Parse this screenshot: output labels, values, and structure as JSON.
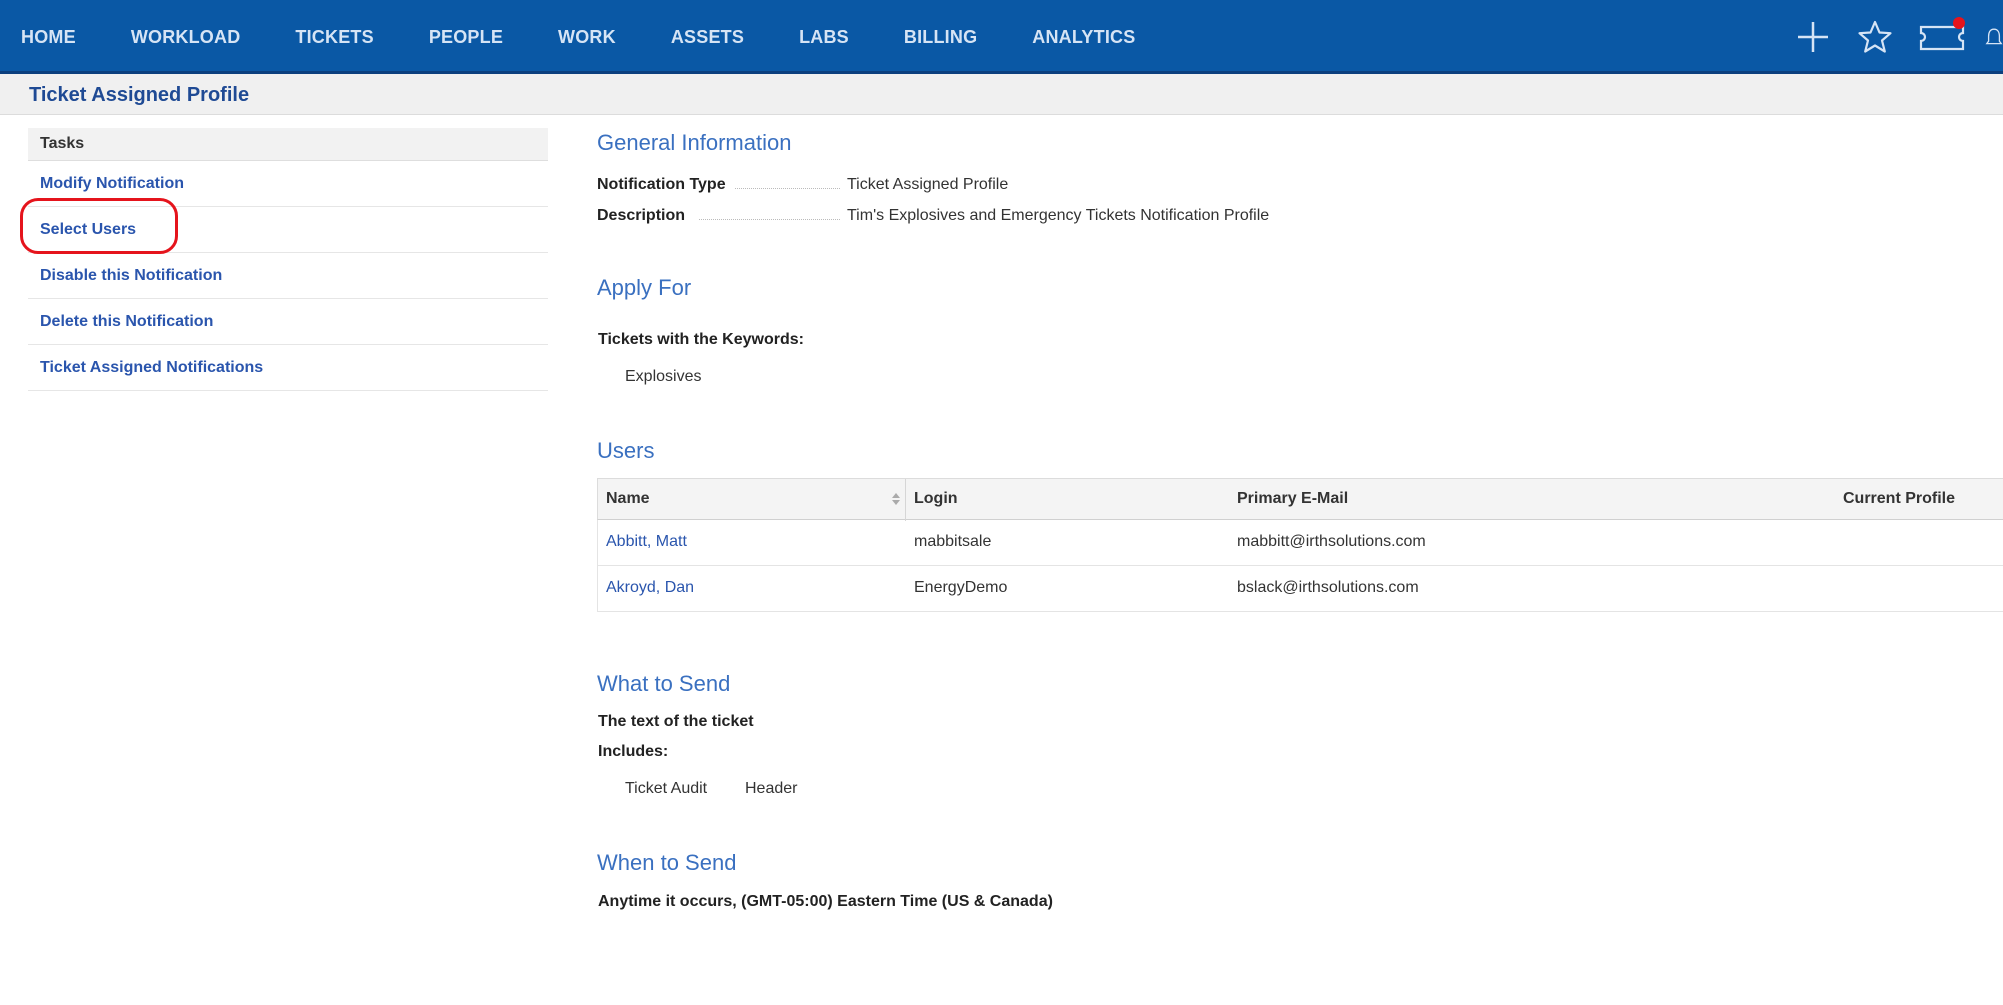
{
  "nav": {
    "items": [
      "HOME",
      "WORKLOAD",
      "TICKETS",
      "PEOPLE",
      "WORK",
      "ASSETS",
      "LABS",
      "BILLING",
      "ANALYTICS"
    ],
    "icons": [
      "plus-icon",
      "star-icon",
      "ticket-icon",
      "bell-icon"
    ],
    "notification_dot_color": "#e5141c"
  },
  "page": {
    "title": "Ticket Assigned Profile"
  },
  "tasks": {
    "header": "Tasks",
    "items": [
      "Modify Notification",
      "Select Users",
      "Disable this Notification",
      "Delete this Notification",
      "Ticket Assigned Notifications"
    ]
  },
  "general": {
    "title": "General Information",
    "notification_type_label": "Notification Type",
    "notification_type_value": "Ticket Assigned Profile",
    "description_label": "Description",
    "description_value": "Tim's Explosives and Emergency Tickets Notification Profile"
  },
  "apply_for": {
    "title": "Apply For",
    "keywords_label": "Tickets with the Keywords:",
    "keyword": "Explosives"
  },
  "users": {
    "title": "Users",
    "columns": [
      "Name",
      "Login",
      "Primary E-Mail",
      "Current Profile"
    ],
    "rows": [
      {
        "name": "Abbitt, Matt",
        "login": "mabbitsale",
        "email": "mabbitt@irthsolutions.com",
        "profile": ""
      },
      {
        "name": "Akroyd, Dan",
        "login": "EnergyDemo",
        "email": "bslack@irthsolutions.com",
        "profile": ""
      }
    ]
  },
  "what_to_send": {
    "title": "What to Send",
    "text_label": "The text of the ticket",
    "includes_label": "Includes:",
    "includes": [
      "Ticket Audit",
      "Header"
    ]
  },
  "when_to_send": {
    "title": "When to Send",
    "value": "Anytime it occurs, (GMT-05:00) Eastern Time (US & Canada)"
  }
}
